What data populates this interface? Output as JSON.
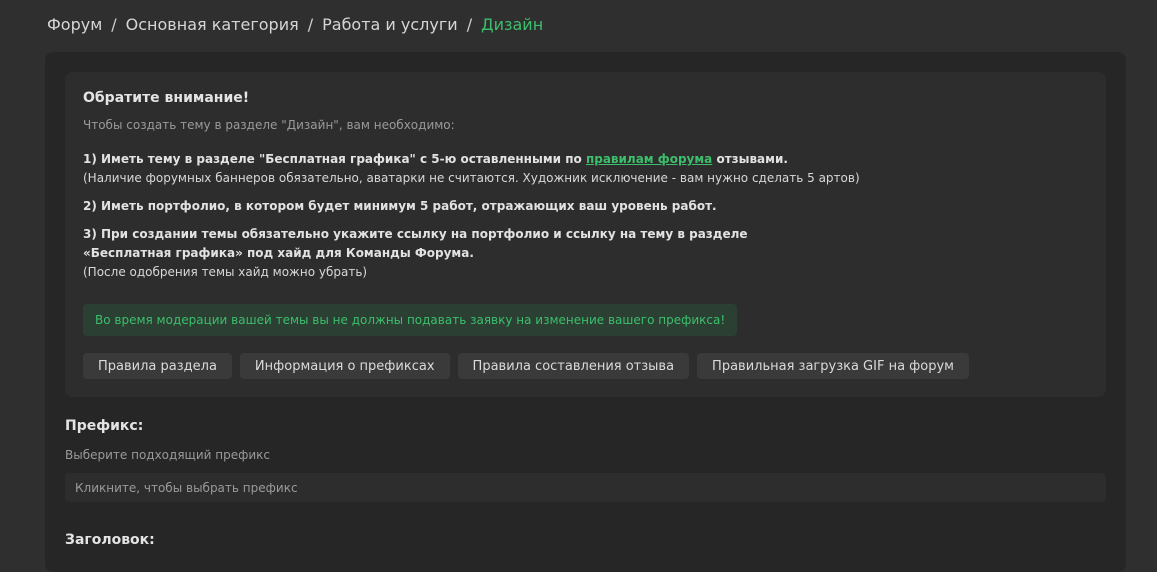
{
  "breadcrumb": {
    "items": [
      "Форум",
      "Основная категория",
      "Работа и услуги"
    ],
    "separator": "/",
    "current": "Дизайн"
  },
  "notice": {
    "title": "Обратите внимание!",
    "subtitle": "Чтобы создать тему в разделе \"Дизайн\", вам необходимо:",
    "rule1": {
      "prefix": "1) Иметь тему в разделе \"Бесплатная графика\" с 5-ю оставленными по ",
      "link": "правилам форума",
      "suffix": " отзывами.",
      "note": "(Наличие форумных баннеров обязательно, аватарки не считаются. Художник исключение - вам нужно сделать 5 артов)"
    },
    "rule2": "2) Иметь портфолио, в котором будет минимум 5 работ, отражающих ваш уровень работ.",
    "rule3": {
      "line1": "3) При создании темы обязательно укажите ссылку на портфолио и ссылку на тему в разделе",
      "line2": "«Бесплатная графика» под хайд для Команды Форума.",
      "note": "(После одобрения темы хайд можно убрать)"
    },
    "alert": "Во время модерации вашей темы вы не должны подавать заявку на изменение вашего префикса!",
    "buttons": [
      "Правила раздела",
      "Информация о префиксах",
      "Правила составления отзыва",
      "Правильная загрузка GIF на форум"
    ]
  },
  "prefix": {
    "label": "Префикс:",
    "hint": "Выберите подходящий префикс",
    "placeholder": "Кликните, чтобы выбрать префикс"
  },
  "title_field": {
    "label": "Заголовок:"
  },
  "colors": {
    "accent": "#3dbe6c",
    "background": "#2f2f2f",
    "panel": "#262626",
    "card": "#2d2d2d"
  }
}
